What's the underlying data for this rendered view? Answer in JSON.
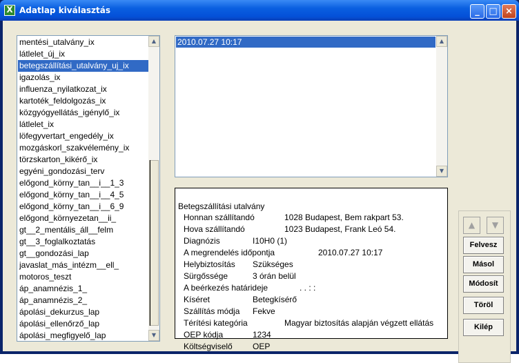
{
  "window": {
    "title": "Adatlap  kiválasztás",
    "app_icon": "X"
  },
  "title_buttons": {
    "minimize": "_",
    "maximize": "□",
    "close": "×"
  },
  "left_list": {
    "selected_index": 2,
    "items": [
      "mentési_utalvány_ix",
      "látlelet_új_ix",
      "betegszállítási_utalvány_uj_ix",
      "igazolás_ix",
      "influenza_nyilatkozat_ix",
      "kartoték_feldolgozás_ix",
      "közgyógyellátás_igénylő_ix",
      "látlelet_ix",
      "löfegyvertart_engedély_ix",
      "mozgáskorl_szakvélemény_ix",
      "törzskarton_kikérő_ix",
      "egyéni_gondozási_terv",
      "előgond_körny_tan__i__1_3",
      "előgond_körny_tan__i__4_5",
      "előgond_körny_tan__i__6_9",
      "előgond_környezetan__ii_",
      "gt__2_mentális_áll__felm",
      "gt__3_foglalkoztatás",
      "gt__gondozási_lap",
      "javaslat_más_intézm__ell_",
      "motoros_teszt",
      "áp_anamnézis_1_",
      "áp_anamnézis_2_",
      "ápolási_dekurzus_lap",
      "ápolási_ellenőrző_lap",
      "ápolási_megfigyelő_lap"
    ]
  },
  "date_list": {
    "items": [
      "2010.07.27 10:17"
    ]
  },
  "detail": {
    "heading": "Betegszállítási utalvány",
    "rows": [
      {
        "label": "Honnan szállítandó",
        "value": "1028 Budapest, Bem rakpart 53."
      },
      {
        "label": "Hova szállítandó",
        "value": "1023 Budapest, Frank Leó 54."
      },
      {
        "label": "Diagnózis",
        "value": "I10H0 (1)"
      },
      {
        "label": "A megrendelés időpontja",
        "value": "2010.07.27 10:17"
      },
      {
        "label": "Helybiztosítás",
        "value": "Szükséges"
      },
      {
        "label": "Sürgőssége",
        "value": "3 órán belül"
      },
      {
        "label": "A beérkezés határideje",
        "value": ".   .   :   :"
      },
      {
        "label": "Kíséret",
        "value": "Betegkísérő"
      },
      {
        "label": "Szállítás módja",
        "value": "Fekve"
      },
      {
        "label": "Térítési kategória",
        "value": "Magyar biztosítás alapján végzett ellátás"
      },
      {
        "label": "OEP kódja",
        "value": "1234"
      },
      {
        "label": "Költségviselő",
        "value": "OEP"
      }
    ]
  },
  "buttons": {
    "up": "▲",
    "down": "▼",
    "felvesz": "Felvesz",
    "masol": "Másol",
    "modosit": "Módosít",
    "torol": "Töröl",
    "kilep": "Kilép"
  },
  "colors": {
    "selection": "#316ac5",
    "titlebar": "#0a5fe0",
    "client": "#ece9d8"
  }
}
